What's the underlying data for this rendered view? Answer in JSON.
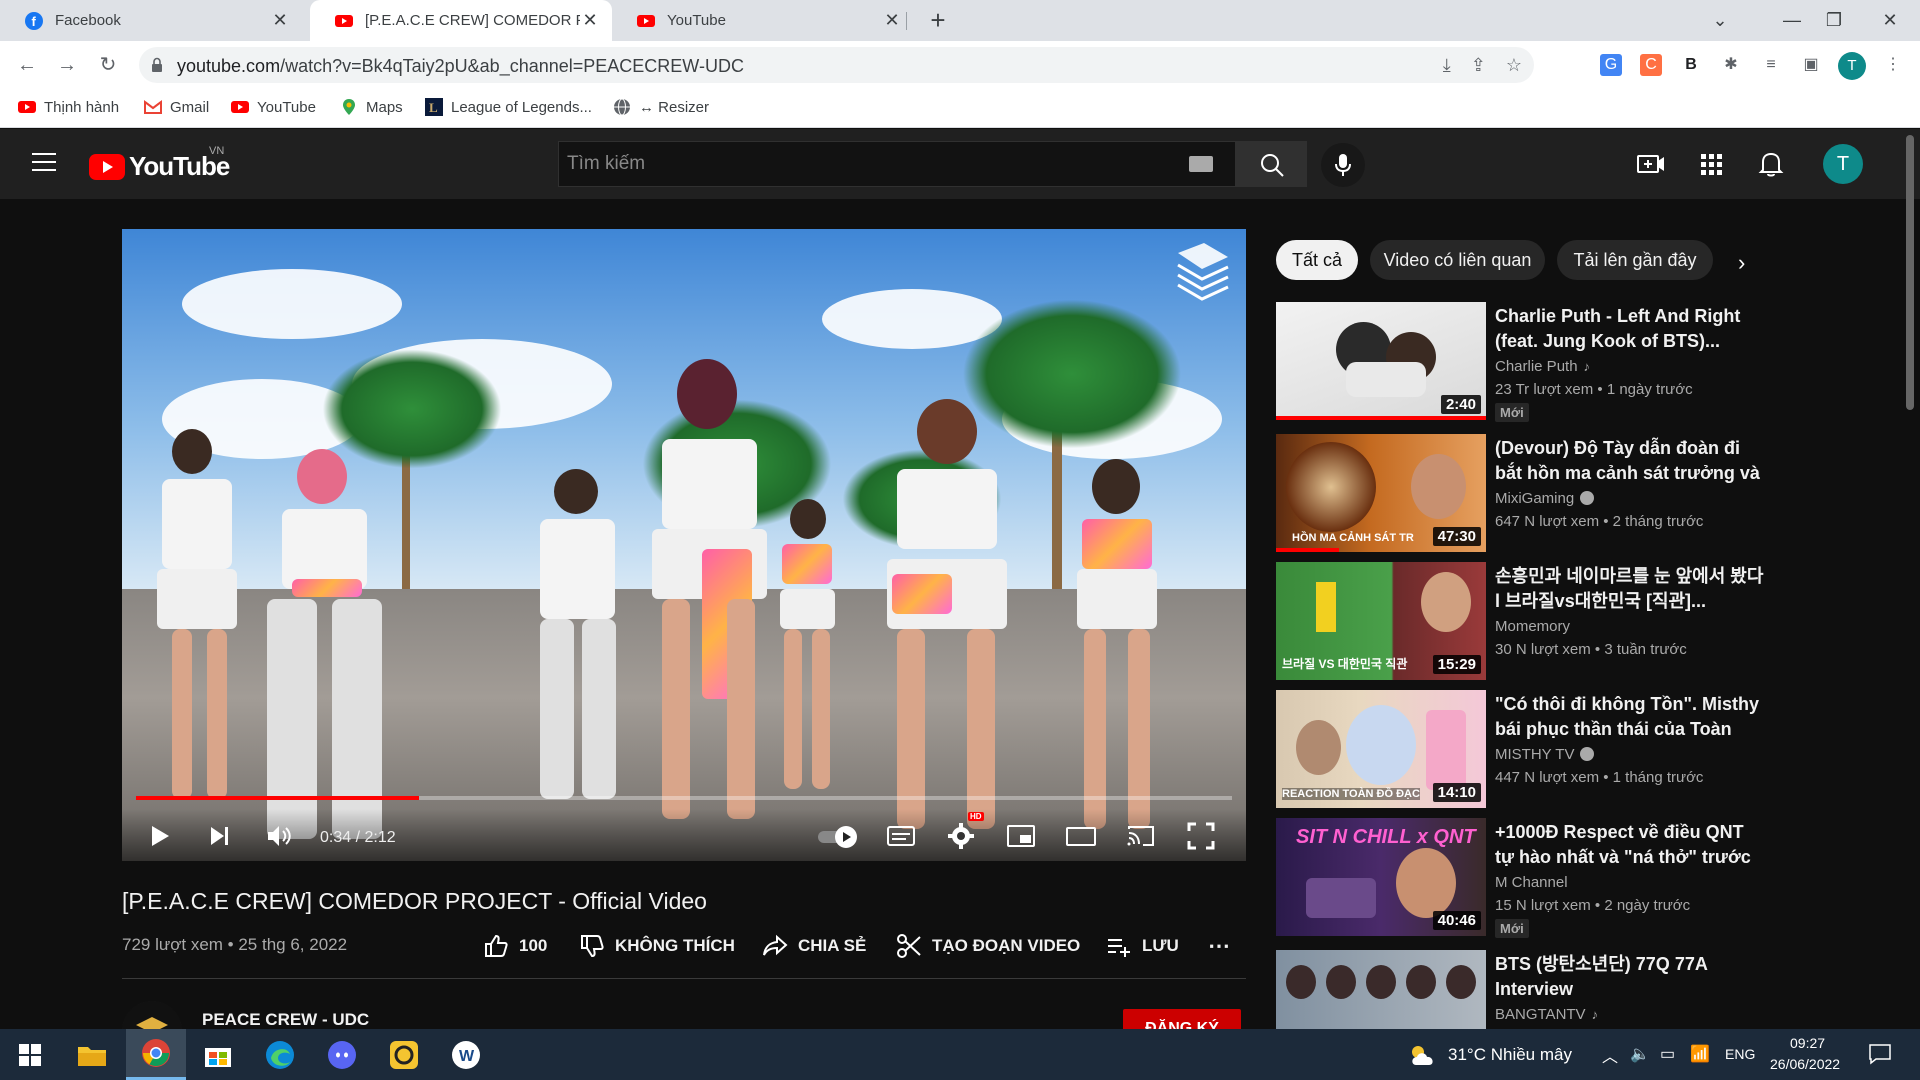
{
  "browser": {
    "tabs": [
      {
        "title": "Facebook",
        "icon": "facebook-icon"
      },
      {
        "title": "[P.E.A.C.E CREW] COMEDOR PRO",
        "icon": "youtube-icon"
      },
      {
        "title": "YouTube",
        "icon": "youtube-icon"
      }
    ],
    "url_host": "youtube.com",
    "url_path": "/watch?v=Bk4qTaiy2pU&ab_channel=PEACECREW-UDC",
    "profile_initial": "T",
    "bookmarks": [
      {
        "label": "Thịnh hành",
        "icon": "youtube-icon"
      },
      {
        "label": "Gmail",
        "icon": "gmail-icon"
      },
      {
        "label": "YouTube",
        "icon": "youtube-icon"
      },
      {
        "label": "Maps",
        "icon": "maps-icon"
      },
      {
        "label": "League of Legends...",
        "icon": "lol-icon"
      },
      {
        "label": "↔ Resizer",
        "icon": "globe-icon"
      }
    ]
  },
  "youtube": {
    "logo_text": "YouTube",
    "country": "VN",
    "search_placeholder": "Tìm kiếm",
    "avatar_initial": "T"
  },
  "player": {
    "time": "0:34 / 2:12",
    "progress_fraction": 0.258,
    "hd_label": "HD"
  },
  "video": {
    "title": "[P.E.A.C.E CREW] COMEDOR PROJECT - Official Video",
    "meta": "729 lượt xem • 25 thg 6, 2022",
    "likes": "100",
    "dislike_label": "KHÔNG THÍCH",
    "share_label": "CHIA SẺ",
    "clip_label": "TẠO ĐOẠN VIDEO",
    "save_label": "LƯU",
    "channel_name": "PEACE CREW - UDC",
    "subscribe_label": "ĐĂNG KÝ"
  },
  "sidebar": {
    "chips": [
      "Tất cả",
      "Video có liên quan",
      "Tải lên gần đây"
    ],
    "recommendations": [
      {
        "title": "Charlie Puth - Left And Right (feat. Jung Kook of BTS)...",
        "channel": "Charlie Puth",
        "channel_mark": "music-note-icon",
        "stats": "23 Tr lượt xem • 1 ngày trước",
        "badge": "Mới",
        "duration": "2:40",
        "watched_fraction": 1.0
      },
      {
        "title": "(Devour) Độ Tày dẫn đoàn đi bắt hồn ma cảnh sát trưởng và cái...",
        "channel": "MixiGaming",
        "channel_mark": "verified-icon",
        "stats": "647 N lượt xem • 2 tháng trước",
        "badge": "",
        "duration": "47:30",
        "thumb_text": "HỒN MA CẢNH SÁT TR",
        "watched_fraction": 0.3
      },
      {
        "title": "손흥민과 네이마르를 눈 앞에서 봤다 l 브라질vs대한민국 [직관]...",
        "channel": "Momemory",
        "channel_mark": "",
        "stats": "30 N lượt xem • 3 tuần trước",
        "badge": "",
        "duration": "15:29",
        "thumb_text": "브라질 VS 대한민국 직관",
        "watched_fraction": 0
      },
      {
        "title": "\"Có thôi đi không Tồn\". Misthy bái phục thần thái của Toàn Đồ...",
        "channel": "MISTHY TV",
        "channel_mark": "verified-icon",
        "stats": "447 N lượt xem • 1 tháng trước",
        "badge": "",
        "duration": "14:10",
        "thumb_text": "REACTION TOÀN ĐỒ ĐẠC",
        "watched_fraction": 0
      },
      {
        "title": "+1000Đ Respect về điều QNT tự hào nhất và \"ná thở\" trước tren...",
        "channel": "M Channel",
        "channel_mark": "",
        "stats": "15 N lượt xem • 2 ngày trước",
        "badge": "Mới",
        "duration": "40:46",
        "thumb_text": "SIT N CHILL x QNT",
        "watched_fraction": 0
      },
      {
        "title": "BTS (방탄소년단) 77Q 77A Interview",
        "channel": "BANGTANTV",
        "channel_mark": "music-note-icon",
        "stats": "",
        "badge": "",
        "duration": "",
        "watched_fraction": 0
      }
    ]
  },
  "taskbar": {
    "weather": "31°C  Nhiều mây",
    "language": "ENG",
    "time": "09:27",
    "date": "26/06/2022"
  }
}
